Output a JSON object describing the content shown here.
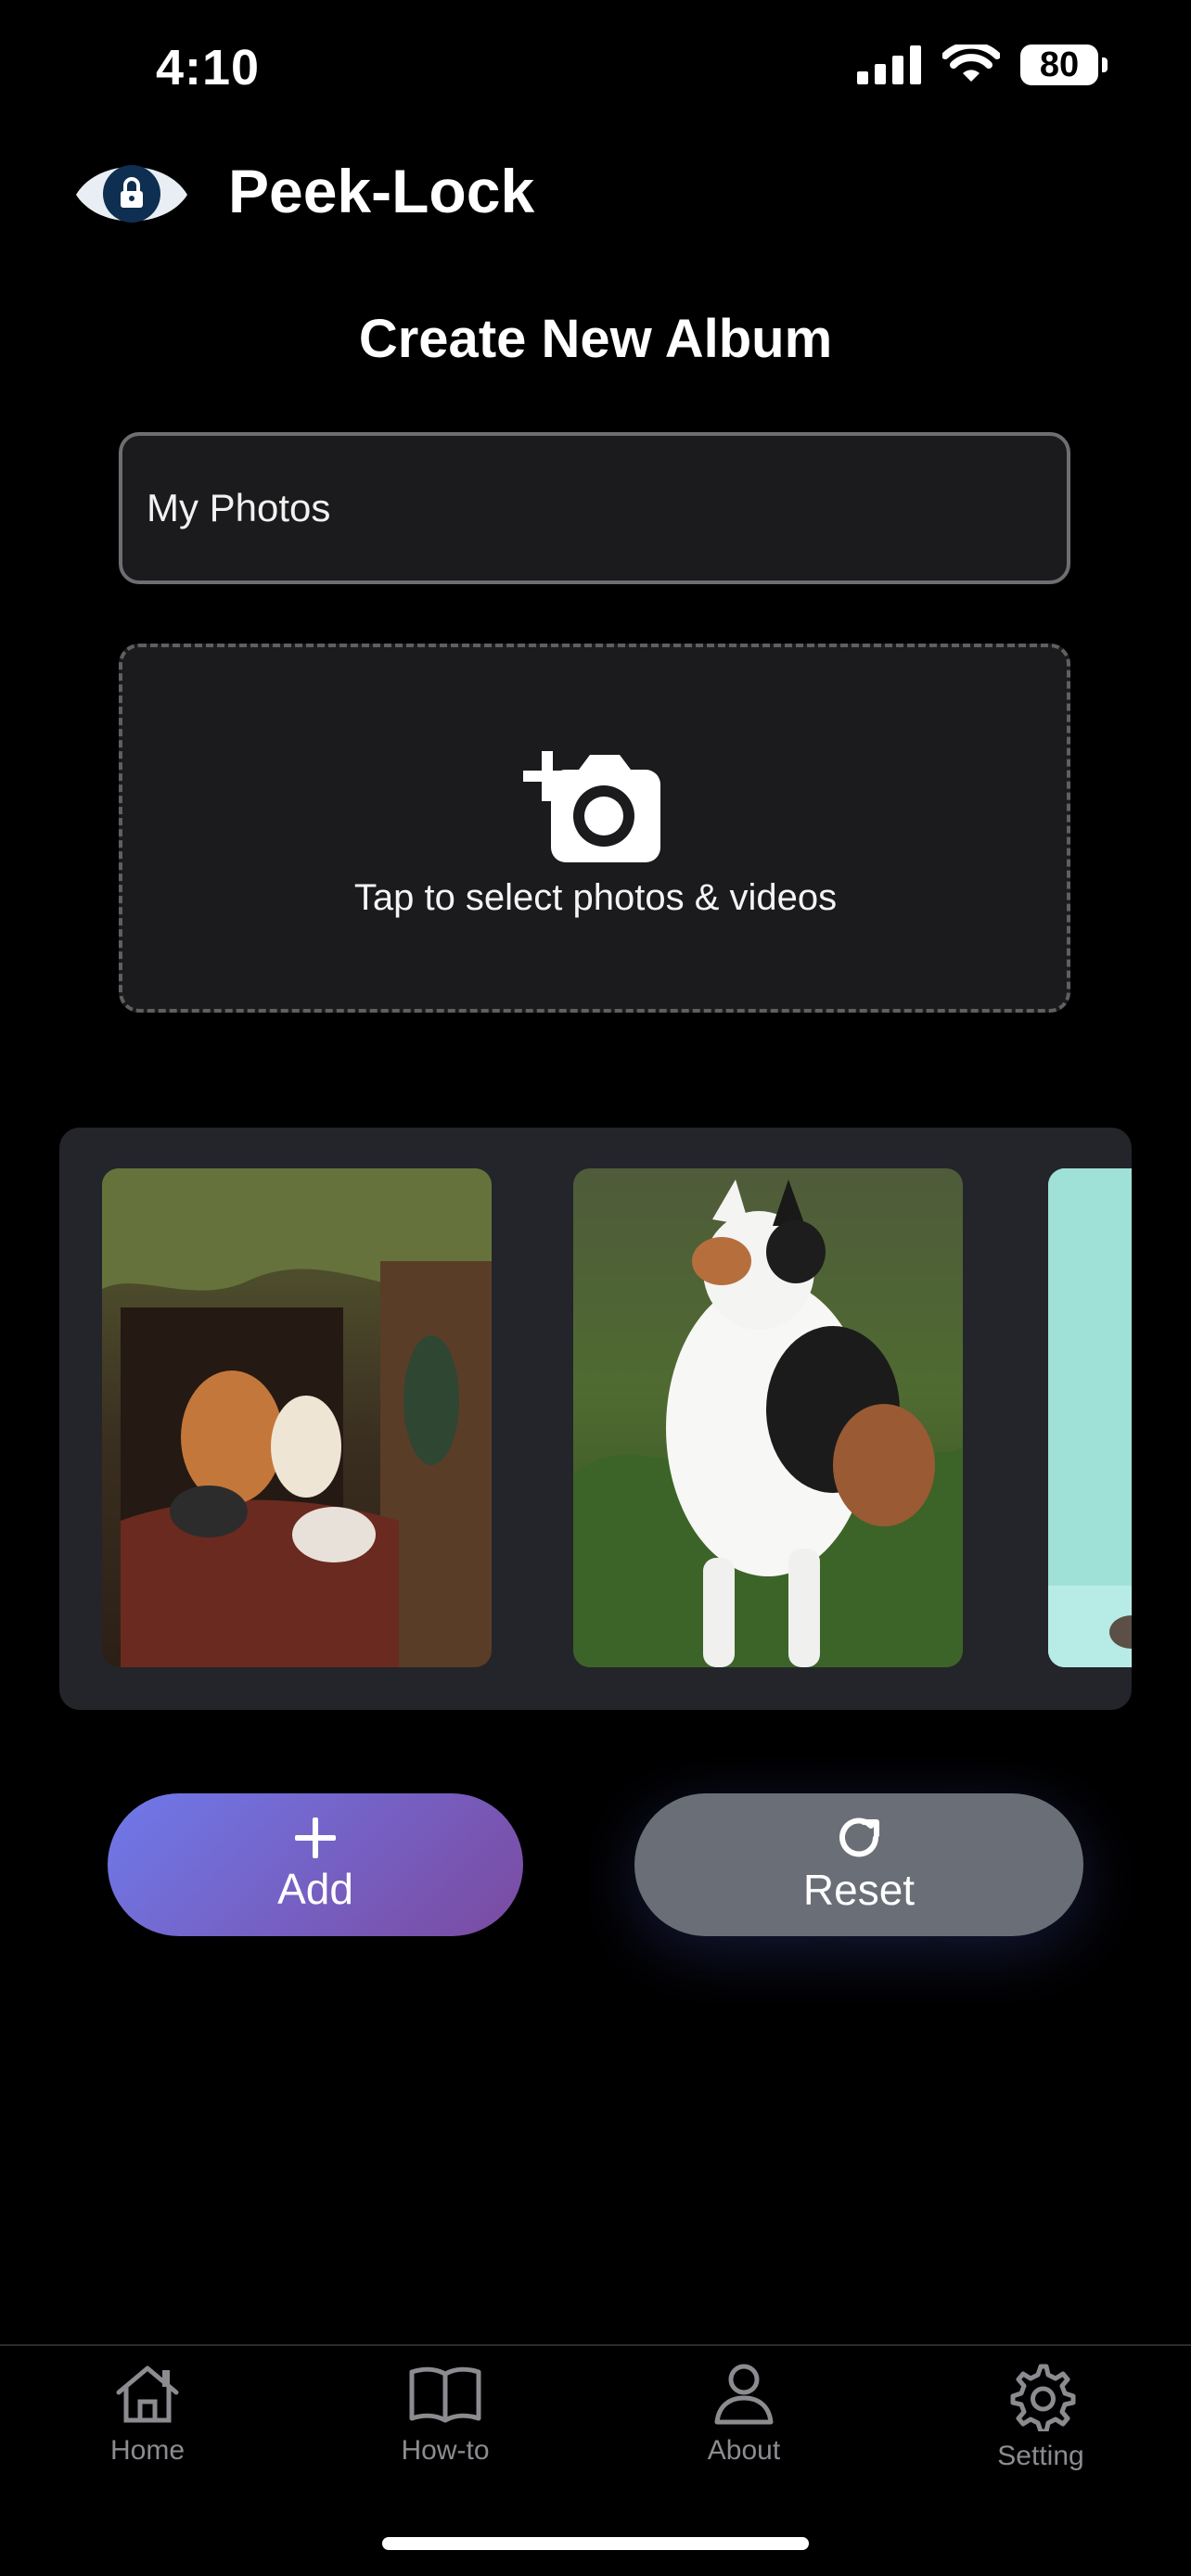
{
  "status_bar": {
    "time": "4:10",
    "battery": "80"
  },
  "header": {
    "app_title": "Peek-Lock"
  },
  "page": {
    "title": "Create New Album"
  },
  "album_form": {
    "name_value": "My Photos"
  },
  "upload": {
    "prompt": "Tap to select photos & videos"
  },
  "buttons": {
    "add_label": "Add",
    "reset_label": "Reset"
  },
  "tabs": [
    {
      "label": "Home"
    },
    {
      "label": "How-to"
    },
    {
      "label": "About"
    },
    {
      "label": "Setting"
    }
  ],
  "colors": {
    "background": "#000000",
    "card": "#1b1b1d",
    "gallery": "#23252b",
    "add_gradient_start": "#6f79ea",
    "add_gradient_end": "#7b4aa0",
    "reset": "#6a6f77",
    "tab_inactive": "#8b8b90"
  }
}
